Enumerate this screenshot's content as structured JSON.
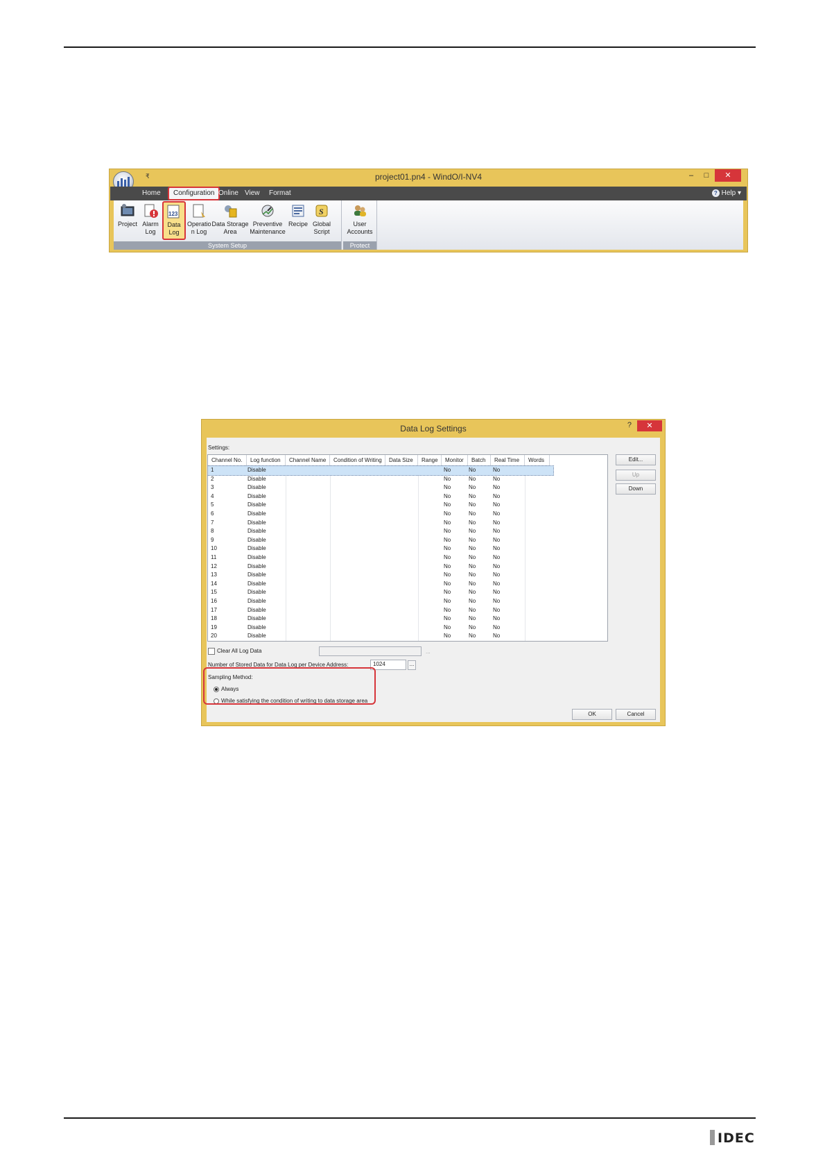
{
  "ribbon_window": {
    "title": "project01.pn4 - WindO/I-NV4",
    "quick_access": "₹",
    "minimize": "–",
    "maximize": "□",
    "close": "✕",
    "tabs": [
      "Home",
      "Configuration",
      "Online",
      "View",
      "Format"
    ],
    "active_tab": "Configuration",
    "help": "Help",
    "groups": [
      {
        "label": "System Setup"
      },
      {
        "label": "Protect"
      }
    ],
    "buttons": [
      {
        "line1": "Project",
        "line2": ""
      },
      {
        "line1": "Alarm",
        "line2": "Log"
      },
      {
        "line1": "Data",
        "line2": "Log"
      },
      {
        "line1": "Operatio",
        "line2": "n Log"
      },
      {
        "line1": "Data Storage",
        "line2": "Area"
      },
      {
        "line1": "Preventive",
        "line2": "Maintenance"
      },
      {
        "line1": "Recipe",
        "line2": ""
      },
      {
        "line1": "Global",
        "line2": "Script"
      },
      {
        "line1": "User",
        "line2": "Accounts"
      }
    ],
    "data_log_icon_text": "123"
  },
  "dialog": {
    "title": "Data Log Settings",
    "help_btn": "?",
    "close_btn": "✕",
    "settings_label": "Settings:",
    "columns": [
      "Channel No.",
      "Log function",
      "Channel Name",
      "Condition of Writing",
      "Data Size",
      "Range",
      "Monitor",
      "Batch",
      "Real Time",
      "Words"
    ],
    "rows": [
      [
        "1",
        "Disable",
        "No",
        "No",
        "No"
      ],
      [
        "2",
        "Disable",
        "No",
        "No",
        "No"
      ],
      [
        "3",
        "Disable",
        "No",
        "No",
        "No"
      ],
      [
        "4",
        "Disable",
        "No",
        "No",
        "No"
      ],
      [
        "5",
        "Disable",
        "No",
        "No",
        "No"
      ],
      [
        "6",
        "Disable",
        "No",
        "No",
        "No"
      ],
      [
        "7",
        "Disable",
        "No",
        "No",
        "No"
      ],
      [
        "8",
        "Disable",
        "No",
        "No",
        "No"
      ],
      [
        "9",
        "Disable",
        "No",
        "No",
        "No"
      ],
      [
        "10",
        "Disable",
        "No",
        "No",
        "No"
      ],
      [
        "11",
        "Disable",
        "No",
        "No",
        "No"
      ],
      [
        "12",
        "Disable",
        "No",
        "No",
        "No"
      ],
      [
        "13",
        "Disable",
        "No",
        "No",
        "No"
      ],
      [
        "14",
        "Disable",
        "No",
        "No",
        "No"
      ],
      [
        "15",
        "Disable",
        "No",
        "No",
        "No"
      ],
      [
        "16",
        "Disable",
        "No",
        "No",
        "No"
      ],
      [
        "17",
        "Disable",
        "No",
        "No",
        "No"
      ],
      [
        "18",
        "Disable",
        "No",
        "No",
        "No"
      ],
      [
        "19",
        "Disable",
        "No",
        "No",
        "No"
      ],
      [
        "20",
        "Disable",
        "No",
        "No",
        "No"
      ]
    ],
    "edit_btn": "Edit...",
    "up_btn": "Up",
    "down_btn": "Down",
    "clear_label": "Clear All Log Data",
    "clear_value": "",
    "stored_label": "Number of Stored Data for Data Log per Device Address:",
    "stored_value": "1024",
    "ellipsis": "...",
    "sampling_label": "Sampling Method:",
    "radio_always": "Always",
    "radio_while": "While satisfying the condition of writing to data storage area",
    "ok_btn": "OK",
    "cancel_btn": "Cancel"
  },
  "footer_logo": "IDEC"
}
